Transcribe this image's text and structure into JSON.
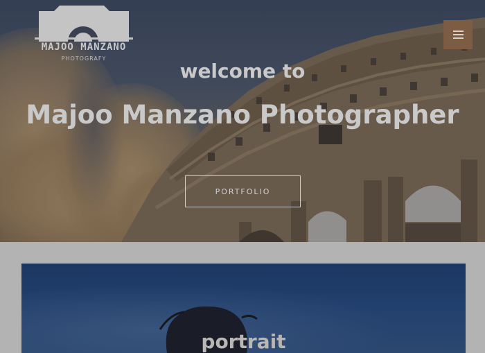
{
  "header": {
    "logo": {
      "name": "MAJOO MANZANO",
      "subtitle": "PHOTOGRAFY"
    },
    "menu_icon": "hamburger-menu-icon"
  },
  "hero": {
    "welcome": "welcome to",
    "headline": "Majoo Manzano Photographer",
    "cta_label": "PORTFOLIO"
  },
  "section": {
    "card_label": "portrait"
  },
  "colors": {
    "accent": "#7d5c44",
    "page_bg": "#b3b3b3",
    "text_light": "#c9c9c9"
  }
}
